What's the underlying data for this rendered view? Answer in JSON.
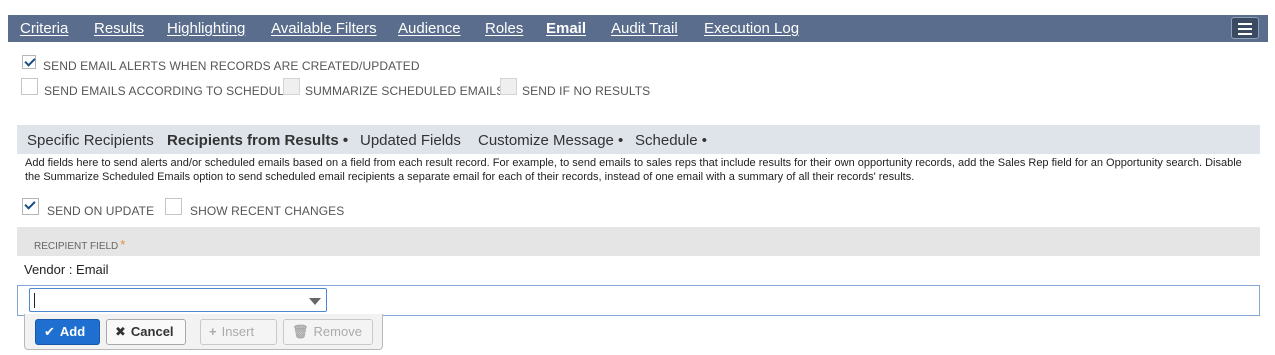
{
  "tabs": [
    "Criteria",
    "Results",
    "Highlighting",
    "Available Filters",
    "Audience",
    "Roles",
    "Email",
    "Audit Trail",
    "Execution Log"
  ],
  "active_tab": "Email",
  "options": {
    "send_alerts": "SEND EMAIL ALERTS WHEN RECORDS ARE CREATED/UPDATED",
    "send_schedule": "SEND EMAILS ACCORDING TO SCHEDULE",
    "summarize": "SUMMARIZE SCHEDULED EMAILS",
    "no_results": "SEND IF NO RESULTS"
  },
  "subtabs": [
    "Specific Recipients",
    "Recipients from Results •",
    "Updated Fields",
    "Customize Message •",
    "Schedule •"
  ],
  "active_subtab": "Recipients from Results •",
  "help_text": "Add fields here to send alerts and/or scheduled emails based on a field from each result record. For example, to send emails to sales reps that include results for their own opportunity records, add the Sales Rep field for an Opportunity search. Disable the Summarize Scheduled Emails option to send scheduled email recipients a separate email for each of their records, instead of one email with a summary of all their records' results.",
  "send_on_update": "SEND ON UPDATE",
  "show_recent_changes": "SHOW RECENT CHANGES",
  "table": {
    "header": "RECIPIENT FIELD",
    "required_mark": "*",
    "rows": [
      "Vendor : Email"
    ]
  },
  "buttons": {
    "add": "Add",
    "cancel": "Cancel",
    "insert": "Insert",
    "remove": "Remove"
  },
  "colors": {
    "topbar": "#5a6d8c",
    "accent": "#1f6fd0",
    "required": "#e88d3b"
  }
}
